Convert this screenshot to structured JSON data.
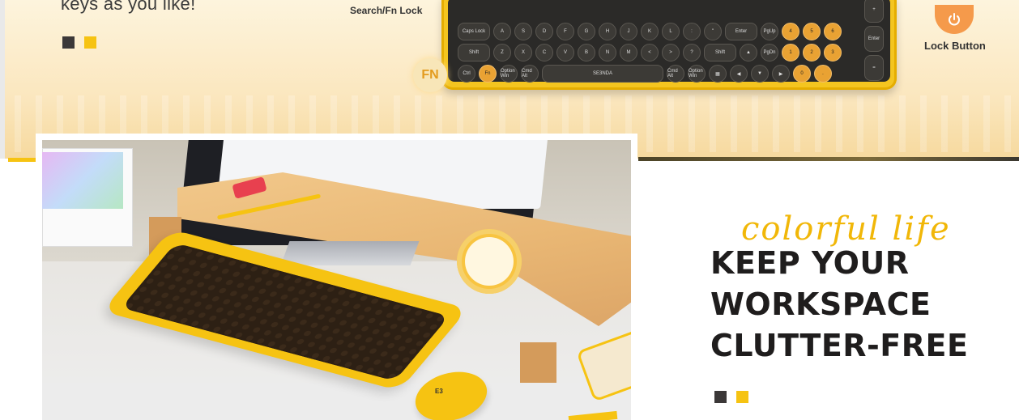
{
  "intro": {
    "text": "keys as you like!"
  },
  "search_lock_label": "Search/Fn Lock",
  "lock": {
    "label": "Lock Button",
    "icon": "power-icon"
  },
  "fn_badge": "FN",
  "keyboard": {
    "row1": [
      "Caps Lock",
      "A",
      "S",
      "D",
      "F",
      "G",
      "H",
      "J",
      "K",
      "L",
      ":",
      "\"",
      "Enter",
      "PgUp",
      "4",
      "5",
      "6"
    ],
    "row2": [
      "Shift",
      "Z",
      "X",
      "C",
      "V",
      "B",
      "N",
      "M",
      "<",
      ">",
      "?",
      "Shift",
      "▲",
      "PgDn",
      "1",
      "2",
      "3"
    ],
    "row3": [
      "Ctrl",
      "Fn",
      "Option Win",
      "Cmd Alt",
      "SE3NDA",
      "Cmd Alt",
      "Option Win",
      "▦",
      "◀",
      "▼",
      "▶",
      "0",
      "."
    ],
    "side_keys": [
      "+",
      "Enter",
      "="
    ]
  },
  "photo": {
    "mouse_brand": "E3"
  },
  "promo": {
    "script": "colorful life",
    "headline_lines": [
      "KEEP YOUR",
      "WORKSPACE",
      "CLUTTER-FREE"
    ]
  },
  "colors": {
    "dark_swatch": "#3b3838",
    "yellow_swatch": "#f6c312",
    "accent": "#f1b708"
  }
}
